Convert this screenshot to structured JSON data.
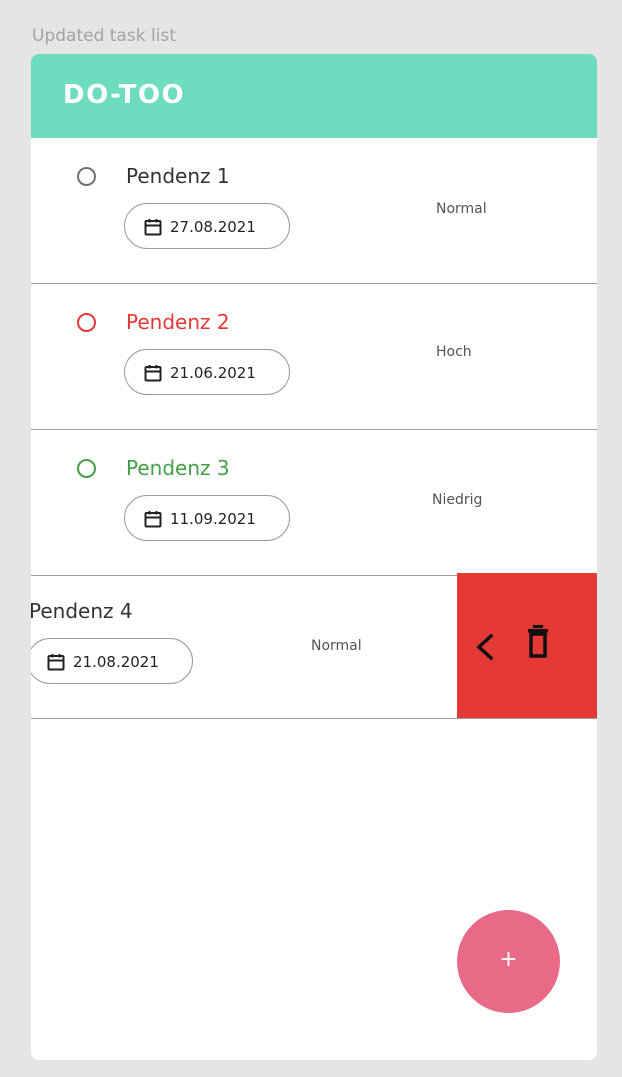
{
  "frame_label": "Updated task list",
  "app": {
    "title": "DO-TOO",
    "header_color": "#6ddcbf"
  },
  "tasks": [
    {
      "title": "Pendenz 1",
      "date": "27.08.2021",
      "priority": "Normal",
      "status_color": "#707070"
    },
    {
      "title": "Pendenz 2",
      "date": "21.06.2021",
      "priority": "Hoch",
      "status_color": "#e53935"
    },
    {
      "title": "Pendenz 3",
      "date": "11.09.2021",
      "priority": "Niedrig",
      "status_color": "#43a047"
    },
    {
      "title": "Pendenz 4",
      "date": "21.08.2021",
      "priority": "Normal",
      "status_color": "#707070"
    }
  ],
  "swipe_actions": {
    "background_color": "#e53935",
    "icons": [
      "chevron-left-icon",
      "trash-icon"
    ]
  },
  "fab": {
    "label": "+",
    "color": "#e86a86"
  }
}
